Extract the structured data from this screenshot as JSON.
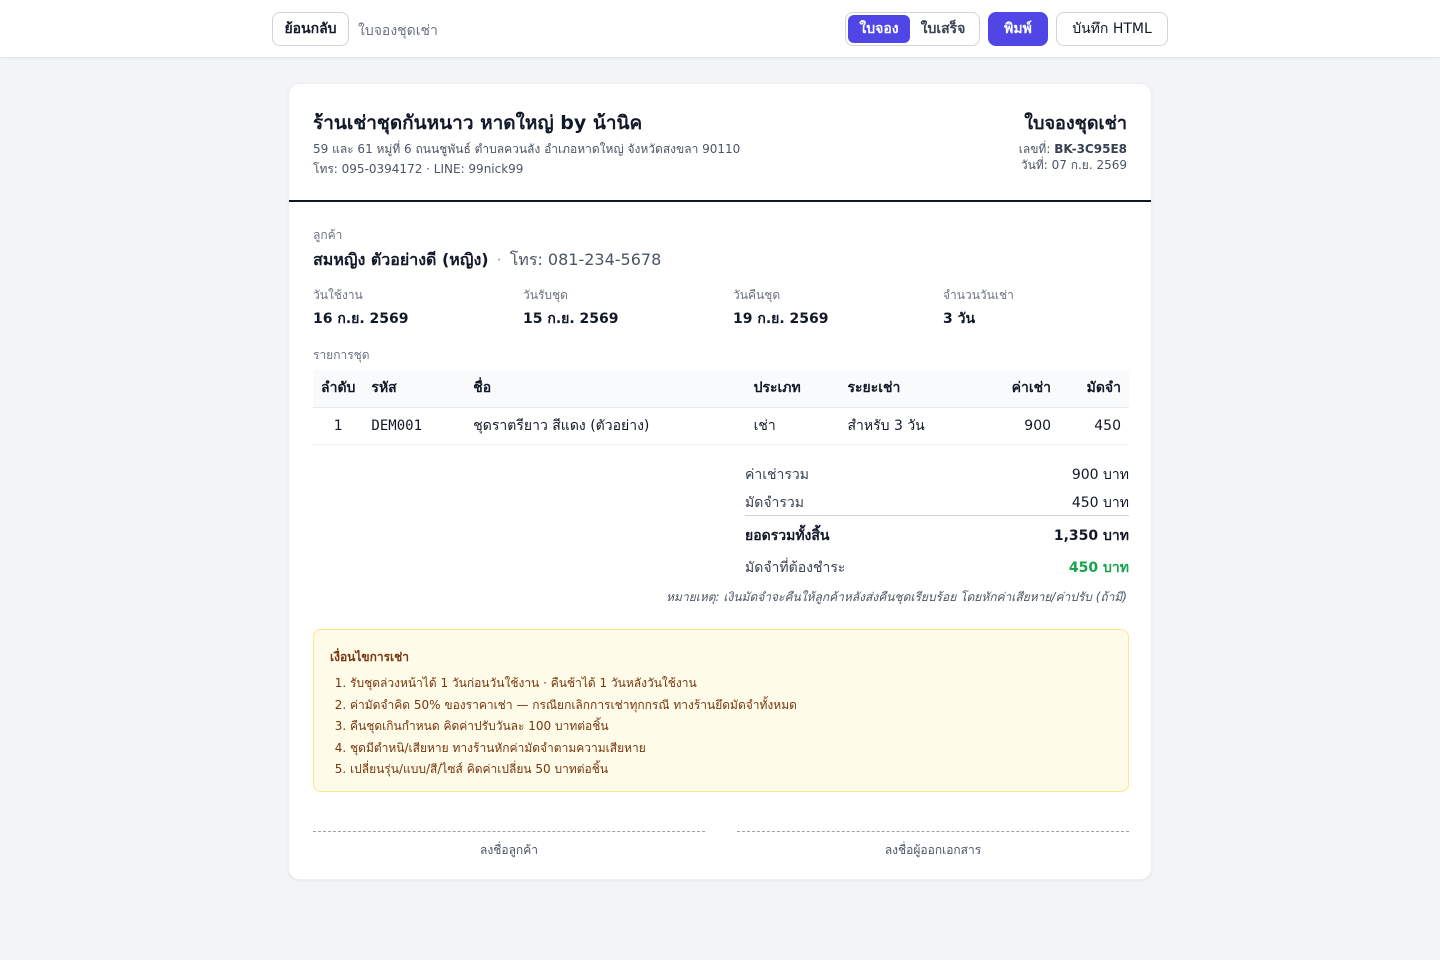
{
  "toolbar": {
    "back_label": "ย้อนกลับ",
    "breadcrumb": "ใบจองชุดเช่า",
    "segments": [
      {
        "label": "ใบจอง",
        "active": true
      },
      {
        "label": "ใบเสร็จ",
        "active": false
      }
    ],
    "print_label": "พิมพ์",
    "save_label": "บันทึก HTML"
  },
  "shop": {
    "name": "ร้านเช่าชุดกันหนาว หาดใหญ่ by น้านิค",
    "address": "59 และ 61 หมู่ที่ 6 ถนนชูพันธ์ ตำบลควนลัง อำเภอหาดใหญ่ จังหวัดสงขลา 90110",
    "contact": "โทร: 095-0394172 · LINE: 99nick99"
  },
  "document": {
    "title": "ใบจองชุดเช่า",
    "number_label": "เลขที่:",
    "number": "BK-3C95E8",
    "date_label": "วันที่:",
    "date": "07 ก.ย. 2569"
  },
  "customer": {
    "label": "ลูกค้า",
    "name": "สมหญิง ตัวอย่างดี (หญิง)",
    "separator": "·",
    "phone": "โทร: 081-234-5678"
  },
  "info": [
    {
      "label": "วันใช้งาน",
      "value": "16 ก.ย. 2569"
    },
    {
      "label": "วันรับชุด",
      "value": "15 ก.ย. 2569"
    },
    {
      "label": "วันคืนชุด",
      "value": "19 ก.ย. 2569"
    },
    {
      "label": "จำนวนวันเช่า",
      "value": "3 วัน"
    }
  ],
  "items": {
    "label": "รายการชุด",
    "columns": [
      "ลำดับ",
      "รหัส",
      "ชื่อ",
      "ประเภท",
      "ระยะเช่า",
      "ค่าเช่า",
      "มัดจำ"
    ],
    "rows": [
      {
        "no": "1",
        "code": "DEM001",
        "name": "ชุดราตรียาว สีแดง (ตัวอย่าง)",
        "type": "เช่า",
        "period": "สำหรับ 3 วัน",
        "rent": "900",
        "deposit": "450"
      }
    ]
  },
  "summary": {
    "rent_total_label": "ค่าเช่ารวม",
    "rent_total": "900 บาท",
    "deposit_total_label": "มัดจำรวม",
    "deposit_total": "450 บาท",
    "grand_total_label": "ยอดรวมทั้งสิ้น",
    "grand_total": "1,350 บาท",
    "deposit_due_label": "มัดจำที่ต้องชำระ",
    "deposit_due": "450 บาท",
    "deposit_due_color": "#16a34a",
    "note": "หมายเหตุ: เงินมัดจำจะคืนให้ลูกค้าหลังส่งคืนชุดเรียบร้อย โดยหักค่าเสียหาย/ค่าปรับ (ถ้ามี)"
  },
  "terms": {
    "title": "เงื่อนไขการเช่า",
    "items": [
      "รับชุดล่วงหน้าได้ 1 วันก่อนวันใช้งาน · คืนช้าได้ 1 วันหลังวันใช้งาน",
      "ค่ามัดจำคิด 50% ของราคาเช่า — กรณียกเลิกการเช่าทุกกรณี ทางร้านยึดมัดจำทั้งหมด",
      "คืนชุดเกินกำหนด คิดค่าปรับวันละ 100 บาทต่อชิ้น",
      "ชุดมีตำหนิ/เสียหาย ทางร้านหักค่ามัดจำตามความเสียหาย",
      "เปลี่ยนรุ่น/แบบ/สี/ไซส์ คิดค่าเปลี่ยน 50 บาทต่อชิ้น"
    ]
  },
  "signatures": {
    "customer": "ลงชื่อลูกค้า",
    "issuer": "ลงชื่อผู้ออกเอกสาร"
  },
  "colors": {
    "accent": "#4f46e5",
    "terms_bg": "#fefce8",
    "terms_border": "#fde68a"
  }
}
